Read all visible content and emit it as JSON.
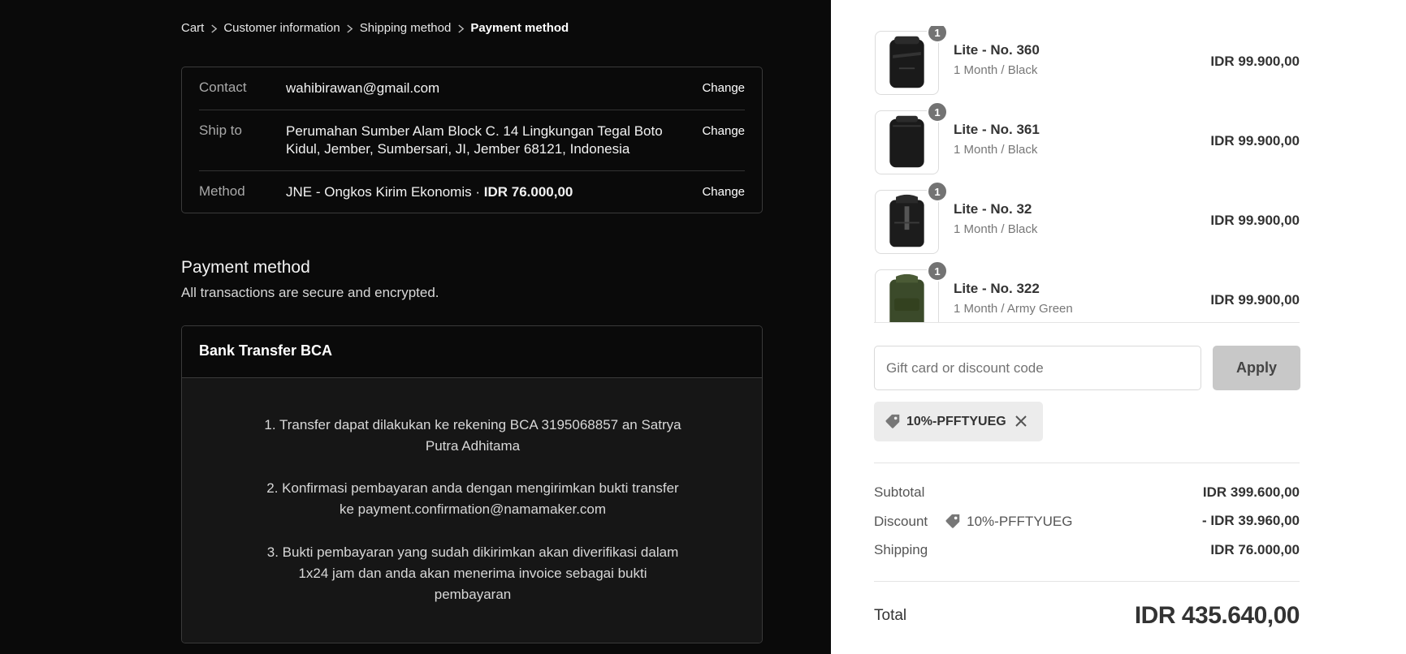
{
  "breadcrumb": {
    "items": [
      "Cart",
      "Customer information",
      "Shipping method"
    ],
    "current": "Payment method"
  },
  "review": {
    "contact": {
      "label": "Contact",
      "value": "wahibirawan@gmail.com",
      "action": "Change"
    },
    "ship_to": {
      "label": "Ship to",
      "value_line1": "Perumahan Sumber Alam Block C. 14 Lingkungan Tegal Boto",
      "value_line2": "Kidul, Jember, Sumbersari, JI, Jember 68121, Indonesia",
      "action": "Change"
    },
    "method": {
      "label": "Method",
      "value": "JNE - Ongkos Kirim Ekonomis · ",
      "price": "IDR 76.000,00",
      "action": "Change"
    }
  },
  "payment": {
    "title": "Payment method",
    "subtitle": "All transactions are secure and encrypted.",
    "option_title": "Bank Transfer BCA",
    "instructions": [
      "1. Transfer dapat dilakukan ke rekening BCA 3195068857 an Satrya Putra Adhitama",
      "2. Konfirmasi pembayaran anda dengan mengirimkan bukti transfer ke payment.confirmation@namamaker.com",
      "3. Bukti pembayaran yang sudah dikirimkan akan diverifikasi dalam 1x24 jam dan anda akan menerima invoice sebagai bukti pembayaran"
    ]
  },
  "items": [
    {
      "name": "Lite - No. 360",
      "variant": "1 Month / Black",
      "price": "IDR 99.900,00",
      "qty": "1",
      "color": "#1a1a1a"
    },
    {
      "name": "Lite - No. 361",
      "variant": "1 Month / Black",
      "price": "IDR 99.900,00",
      "qty": "1",
      "color": "#1a1a1a"
    },
    {
      "name": "Lite - No. 32",
      "variant": "1 Month / Black",
      "price": "IDR 99.900,00",
      "qty": "1",
      "color": "#1a1a1a"
    },
    {
      "name": "Lite - No. 322",
      "variant": "1 Month / Army Green",
      "price": "IDR 99.900,00",
      "qty": "1",
      "color": "#3b4a2a"
    }
  ],
  "discount": {
    "placeholder": "Gift card or discount code",
    "apply_label": "Apply",
    "applied_code": "10%-PFFTYUEG"
  },
  "summary": {
    "subtotal_label": "Subtotal",
    "subtotal_value": "IDR 399.600,00",
    "discount_label": "Discount",
    "discount_code": "10%-PFFTYUEG",
    "discount_value": "- IDR 39.960,00",
    "shipping_label": "Shipping",
    "shipping_value": "IDR 76.000,00",
    "total_label": "Total",
    "total_value": "IDR 435.640,00"
  }
}
